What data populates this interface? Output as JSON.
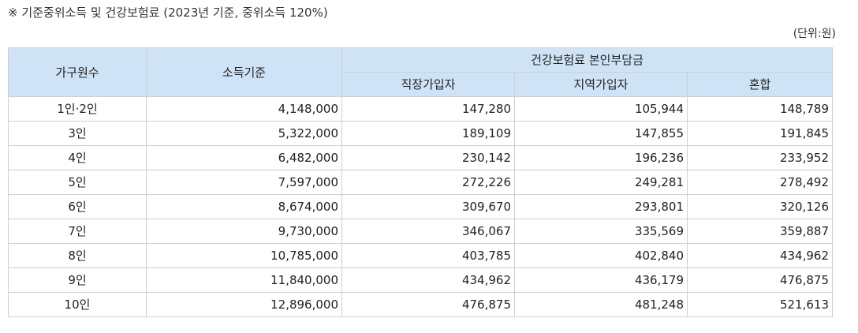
{
  "caption": "※ 기준중위소득 및 건강보험료 (2023년 기준, 중위소득 120%)",
  "unit": "(단위:원)",
  "headers": {
    "household": "가구원수",
    "income": "소득기준",
    "premium_group": "건강보험료 본인부담금",
    "employee": "직장가입자",
    "regional": "지역가입자",
    "mixed": "혼합"
  },
  "rows": [
    {
      "size": "1인·2인",
      "income": "4,148,000",
      "employee": "147,280",
      "regional": "105,944",
      "mixed": "148,789"
    },
    {
      "size": "3인",
      "income": "5,322,000",
      "employee": "189,109",
      "regional": "147,855",
      "mixed": "191,845"
    },
    {
      "size": "4인",
      "income": "6,482,000",
      "employee": "230,142",
      "regional": "196,236",
      "mixed": "233,952"
    },
    {
      "size": "5인",
      "income": "7,597,000",
      "employee": "272,226",
      "regional": "249,281",
      "mixed": "278,492"
    },
    {
      "size": "6인",
      "income": "8,674,000",
      "employee": "309,670",
      "regional": "293,801",
      "mixed": "320,126"
    },
    {
      "size": "7인",
      "income": "9,730,000",
      "employee": "346,067",
      "regional": "335,569",
      "mixed": "359,887"
    },
    {
      "size": "8인",
      "income": "10,785,000",
      "employee": "403,785",
      "regional": "402,840",
      "mixed": "434,962"
    },
    {
      "size": "9인",
      "income": "11,840,000",
      "employee": "434,962",
      "regional": "436,179",
      "mixed": "476,875"
    },
    {
      "size": "10인",
      "income": "12,896,000",
      "employee": "476,875",
      "regional": "481,248",
      "mixed": "521,613"
    }
  ]
}
